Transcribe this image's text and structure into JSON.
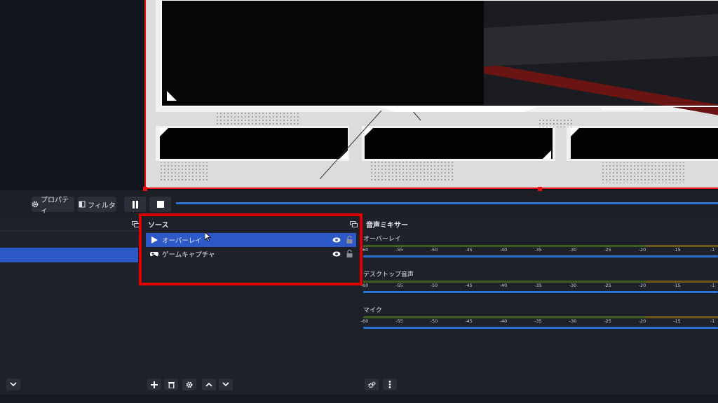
{
  "controls": {
    "properties_label": "プロパティ",
    "filters_label": "フィルタ"
  },
  "sources": {
    "title": "ソース",
    "items": [
      {
        "label": "オーバーレイ",
        "icon": "play-icon",
        "selected": true
      },
      {
        "label": "ゲームキャプチャ",
        "icon": "gamepad-icon",
        "selected": false
      }
    ]
  },
  "mixer": {
    "title": "音声ミキサー",
    "ticks": [
      "-60",
      "-55",
      "-50",
      "-45",
      "-40",
      "-35",
      "-30",
      "-25",
      "-20",
      "-15",
      "-1"
    ],
    "channels": [
      {
        "name": "オーバーレイ"
      },
      {
        "name": "デスクトップ音声"
      },
      {
        "name": "マイク"
      }
    ]
  },
  "colors": {
    "highlight_box": "#e00000",
    "selection": "#2d58c8",
    "slider": "#2d73d6"
  }
}
